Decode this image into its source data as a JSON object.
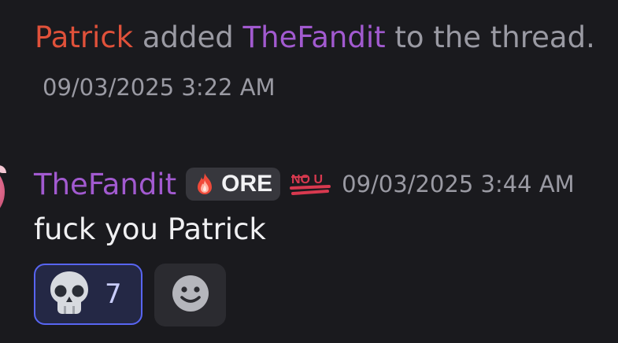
{
  "system_message": {
    "actor": "Patrick",
    "action_text": "added",
    "target": "TheFandit",
    "suffix_text": "to the thread.",
    "timestamp": "09/03/2025 3:22 AM"
  },
  "message": {
    "author": "TheFandit",
    "server_tag": "ORE",
    "badge": "NO U",
    "timestamp": "09/03/2025 3:44 AM",
    "text": "fuck you Patrick"
  },
  "reactions": [
    {
      "emoji": "skull-icon",
      "count": "7",
      "active": true
    }
  ],
  "colors": {
    "background": "#1a1a1e",
    "actor": "#e0513a",
    "username": "#a25ad0",
    "muted": "#9a9aa3",
    "reaction_active_border": "#5865f2"
  }
}
